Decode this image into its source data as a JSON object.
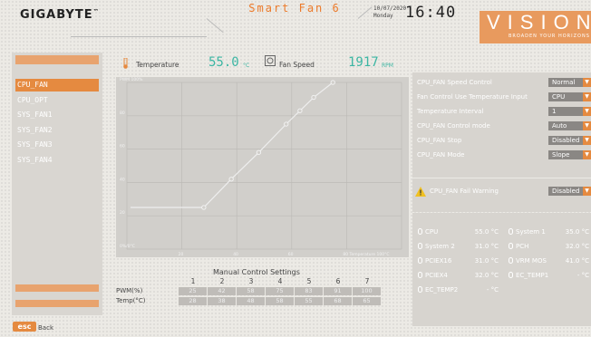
{
  "header": {
    "logo": "GIGABYTE",
    "title": "Smart Fan 6",
    "date": "10/07/2020",
    "day": "Monday",
    "time": "16:40",
    "brand": "VISION",
    "tagline": "BROADEN YOUR HORIZONS"
  },
  "fans": [
    "CPU_FAN",
    "CPU_OPT",
    "SYS_FAN1",
    "SYS_FAN2",
    "SYS_FAN3",
    "SYS_FAN4"
  ],
  "graph": {
    "temp_label": "Temperature",
    "temp_value": "55.0",
    "temp_unit": "°C",
    "speed_label": "Fan Speed",
    "speed_value": "1917",
    "speed_unit": "RPM",
    "y_labels": [
      "PWM 100%",
      "80",
      "60",
      "40",
      "20",
      "0%/0°C"
    ],
    "x_labels": [
      "20",
      "40",
      "60",
      "80 Temperature 100°C"
    ],
    "curve": [
      {
        "temp": 28,
        "pwm": 25
      },
      {
        "temp": 38,
        "pwm": 42
      },
      {
        "temp": 48,
        "pwm": 58
      },
      {
        "temp": 58,
        "pwm": 75
      },
      {
        "temp": 63,
        "pwm": 83
      },
      {
        "temp": 68,
        "pwm": 91
      },
      {
        "temp": 75,
        "pwm": 100
      }
    ]
  },
  "manual": {
    "title": "Manual Control Settings",
    "pwm_label": "PWM(%)",
    "temp_label": "Temp(°C)",
    "points": [
      "1",
      "2",
      "3",
      "4",
      "5",
      "6",
      "7"
    ],
    "pwm": [
      "25",
      "42",
      "58",
      "75",
      "83",
      "91",
      "100"
    ],
    "temp": [
      "28",
      "38",
      "48",
      "58",
      "55",
      "68",
      "65"
    ]
  },
  "settings": [
    {
      "label": "CPU_FAN Speed Control",
      "value": "Normal"
    },
    {
      "label": "Fan Control Use Temperature Input",
      "value": "CPU"
    },
    {
      "label": "Temperature Interval",
      "value": "1"
    },
    {
      "label": "CPU_FAN Control mode",
      "value": "Auto"
    },
    {
      "label": "CPU_FAN Stop",
      "value": "Disabled"
    },
    {
      "label": "CPU_FAN Mode",
      "value": "Slope"
    }
  ],
  "warning": {
    "label": "CPU_FAN Fail Warning",
    "value": "Disabled"
  },
  "temps": [
    {
      "name": "CPU",
      "value": "55.0 °C"
    },
    {
      "name": "System 1",
      "value": "35.0 °C"
    },
    {
      "name": "System 2",
      "value": "31.0 °C"
    },
    {
      "name": "PCH",
      "value": "32.0 °C"
    },
    {
      "name": "PCIEX16",
      "value": "31.0 °C"
    },
    {
      "name": "VRM MOS",
      "value": "41.0 °C"
    },
    {
      "name": "PCIEX4",
      "value": "32.0 °C"
    },
    {
      "name": "EC_TEMP1",
      "value": "- °C"
    },
    {
      "name": "EC_TEMP2",
      "value": "- °C"
    }
  ],
  "footer": {
    "esc": "esc",
    "back": "Back"
  },
  "colors": {
    "accent": "#e58a40",
    "teal": "#3cb6a3"
  }
}
